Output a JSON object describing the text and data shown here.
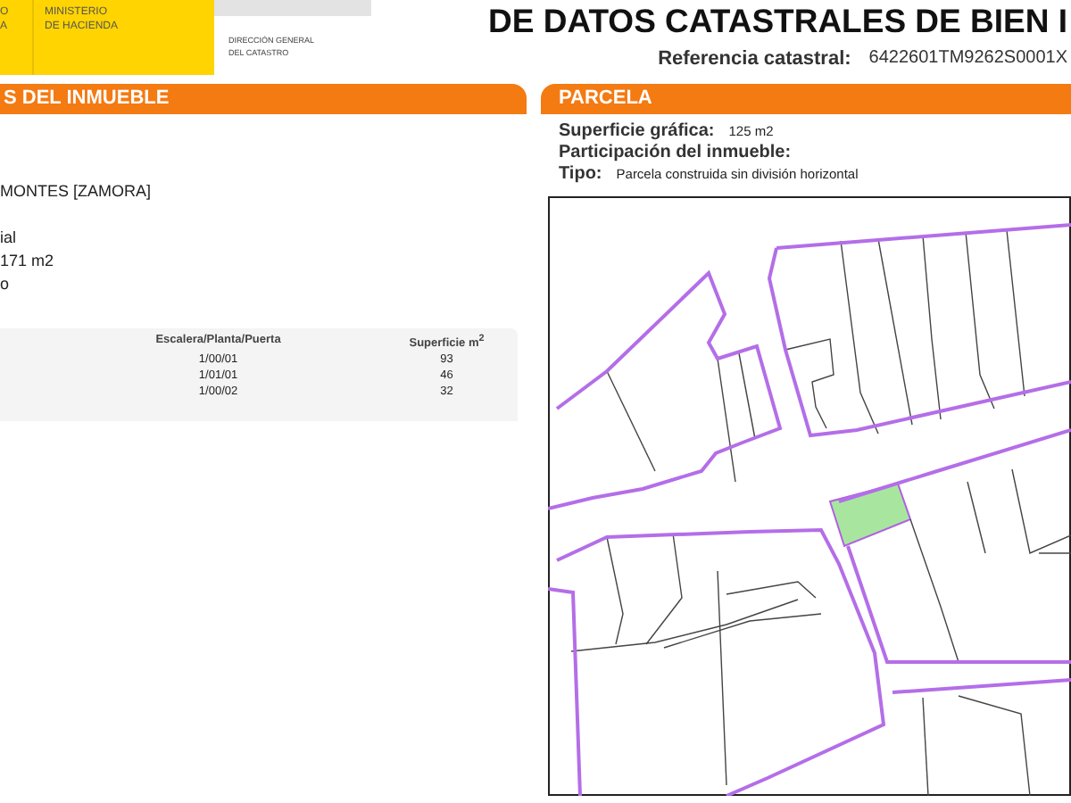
{
  "header": {
    "logo_lines": [
      "O",
      "A"
    ],
    "ministry_lines": [
      "MINISTERIO",
      "DE HACIENDA"
    ],
    "agency_lines": [
      "DIRECCIÓN GENERAL",
      "DEL CATASTRO"
    ],
    "title": "DE DATOS CATASTRALES DE BIEN I",
    "reference_label": "Referencia catastral:",
    "reference_value": "6422601TM9262S0001X"
  },
  "left": {
    "heading": "S DEL INMUEBLE",
    "lines": [
      "MONTES [ZAMORA]",
      "ial",
      "171 m2",
      "o"
    ],
    "table": {
      "columns": [
        "Escalera/Planta/Puerta",
        "Superficie m$^{2}$"
      ],
      "rows": [
        [
          "1/00/01",
          "93"
        ],
        [
          "1/01/01",
          "46"
        ],
        [
          "1/00/02",
          "32"
        ]
      ]
    }
  },
  "parcel": {
    "heading": "PARCELA",
    "fields": [
      {
        "label": "Superficie gráfica:",
        "value": "125 m2"
      },
      {
        "label": "Participación del inmueble:"
      },
      {
        "label": "Tipo:",
        "value": "Parcela construida sin división horizontal"
      }
    ]
  }
}
